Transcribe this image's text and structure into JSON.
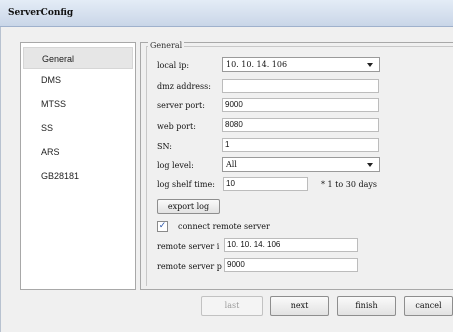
{
  "window": {
    "title": "ServerConfig"
  },
  "nav": {
    "items": [
      {
        "label": "General",
        "active": true
      },
      {
        "label": "DMS",
        "active": false
      },
      {
        "label": "MTSS",
        "active": false
      },
      {
        "label": "SS",
        "active": false
      },
      {
        "label": "ARS",
        "active": false
      },
      {
        "label": "GB28181",
        "active": false
      }
    ]
  },
  "general": {
    "group_title": "General",
    "local_ip": {
      "label": "local ip:",
      "value": "10. 10. 14. 106"
    },
    "dmz_address": {
      "label": "dmz address:",
      "value": ""
    },
    "server_port": {
      "label": "server port:",
      "value": "9000"
    },
    "web_port": {
      "label": "web port:",
      "value": "8080"
    },
    "sn": {
      "label": "SN:",
      "value": "1"
    },
    "log_level": {
      "label": "log level:",
      "value": "All"
    },
    "log_shelf_time": {
      "label": "log shelf time:",
      "value": "10",
      "hint": "* 1 to 30 days"
    },
    "export_log_label": "export log",
    "connect_remote": {
      "label": "connect remote server",
      "checked": true
    },
    "remote_server_ip": {
      "label": "remote server i",
      "value": "10. 10. 14. 106"
    },
    "remote_server_port": {
      "label": "remote server p",
      "value": "9000"
    }
  },
  "footer": {
    "last_label": "last",
    "next_label": "next",
    "finish_label": "finish",
    "cancel_label": "cancel"
  }
}
